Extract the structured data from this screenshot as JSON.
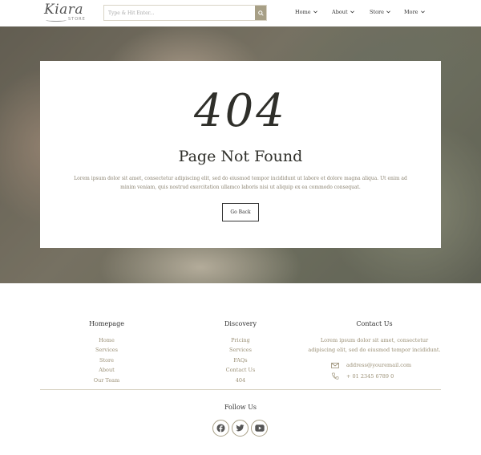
{
  "header": {
    "logo": {
      "name": "Kiara",
      "sub": "STORE"
    },
    "search": {
      "placeholder": "Type & Hit Enter..."
    },
    "nav": [
      {
        "label": "Home"
      },
      {
        "label": "About"
      },
      {
        "label": "Store"
      },
      {
        "label": "More"
      }
    ]
  },
  "hero": {
    "code": "404",
    "title": "Page Not Found",
    "text": "Lorem ipsum dolor sit amet, consectetur adipiscing elit, sed do eiusmod tempor incididunt ut labore et dolore magna aliqua. Ut enim ad minim veniam, quis nostrud exercitation ullamco laboris nisi ut aliquip ex ea commodo consequat.",
    "button_label": "Go Back"
  },
  "footer": {
    "homepage": {
      "title": "Homepage",
      "items": [
        "Home",
        "Services",
        "Store",
        "About",
        "Our Team"
      ]
    },
    "discovery": {
      "title": "Discovery",
      "items": [
        "Pricing",
        "Services",
        "FAQs",
        "Contact Us",
        "404"
      ]
    },
    "contact": {
      "title": "Contact Us",
      "text": "Lorem ipsum dolor sit amet, consectetur adipiscing elit, sed do eiusmod tempor incididunt.",
      "email": "address@youremail.com",
      "phone": "+ 01 2345 6789 0"
    },
    "follow": {
      "title": "Follow Us",
      "icons": [
        "facebook-icon",
        "twitter-icon",
        "youtube-icon"
      ]
    }
  },
  "colors": {
    "accent": "#a79f86",
    "text_muted": "#9a8f75",
    "dark": "#2f2f2a"
  }
}
